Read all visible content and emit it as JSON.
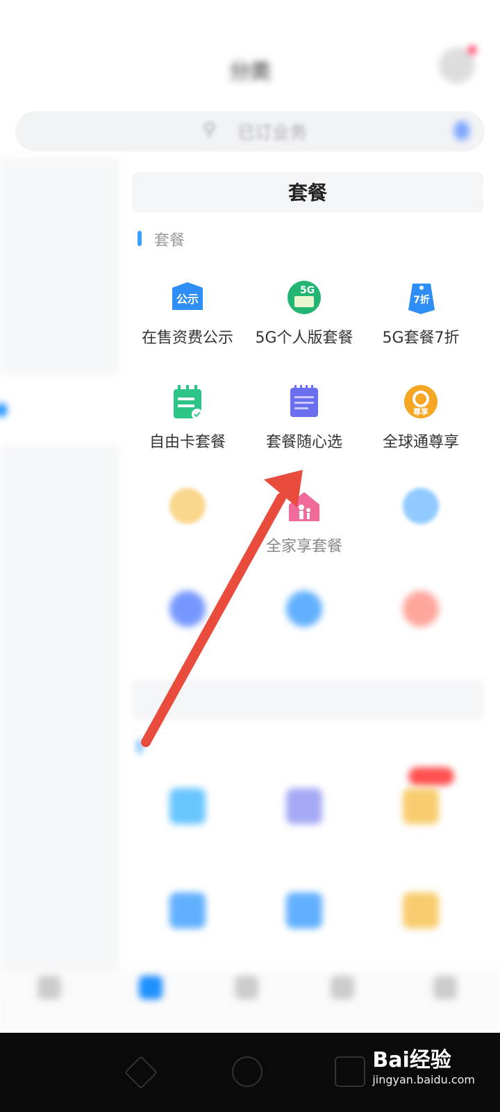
{
  "status_bar": {
    "left": "",
    "right": ""
  },
  "header": {
    "title": "分类"
  },
  "search": {
    "placeholder": "已订业务"
  },
  "sidebar": {
    "items": [
      {
        "label": ""
      },
      {
        "label": ""
      },
      {
        "label": ""
      },
      {
        "label": "",
        "active": true
      },
      {
        "label": ""
      },
      {
        "label": ""
      },
      {
        "label": ""
      },
      {
        "label": ""
      },
      {
        "label": ""
      },
      {
        "label": ""
      },
      {
        "label": ""
      }
    ]
  },
  "panel": {
    "title": "套餐"
  },
  "section": {
    "label": "套餐"
  },
  "grid": [
    {
      "label": "在售资费公示",
      "icon": "gongshi-icon",
      "color": "#2f8ef5"
    },
    {
      "label": "5G个人版套餐",
      "icon": "5g-icon",
      "color": "#22b573"
    },
    {
      "label": "5G套餐7折",
      "icon": "7zhe-tag-icon",
      "color": "#2f8ef5"
    },
    {
      "label": "自由卡套餐",
      "icon": "notepad-icon",
      "color": "#2fc487"
    },
    {
      "label": "套餐随心选",
      "icon": "checklist-icon",
      "color": "#6a6ff0"
    },
    {
      "label": "全球通尊享",
      "icon": "zunxiang-icon",
      "color": "#f5a623"
    },
    {
      "label": "",
      "icon": "changxiang-icon",
      "color": "#f5b731"
    },
    {
      "label": "全家享套餐",
      "icon": "family-home-icon",
      "color": "#f06b9a"
    },
    {
      "label": "",
      "icon": "paper-plane-icon",
      "color": "#3aa0ff"
    }
  ],
  "more_row": [
    {
      "label": "",
      "color": "#3b6bff"
    },
    {
      "label": "",
      "color": "#1e8fff"
    },
    {
      "label": "",
      "color": "#ff6b5a"
    }
  ],
  "section2": {
    "title": "",
    "label": ""
  },
  "section2_items": [
    {
      "label": "",
      "color": "#2aaeff"
    },
    {
      "label": "",
      "color": "#6a6ff0"
    },
    {
      "label": "",
      "color": "#f5b731"
    },
    {
      "label": "",
      "color": "#1e8fff"
    },
    {
      "label": "",
      "color": "#1e8fff"
    },
    {
      "label": "",
      "color": "#f5b731"
    }
  ],
  "tabbar": {
    "items": [
      {
        "label": ""
      },
      {
        "label": ""
      },
      {
        "label": ""
      },
      {
        "label": ""
      },
      {
        "label": ""
      }
    ]
  },
  "watermark": {
    "brand": "Bai经验",
    "url": "jingyan.baidu.com"
  },
  "colors": {
    "accent": "#1e90ff",
    "arrow": "#e94b3c"
  }
}
